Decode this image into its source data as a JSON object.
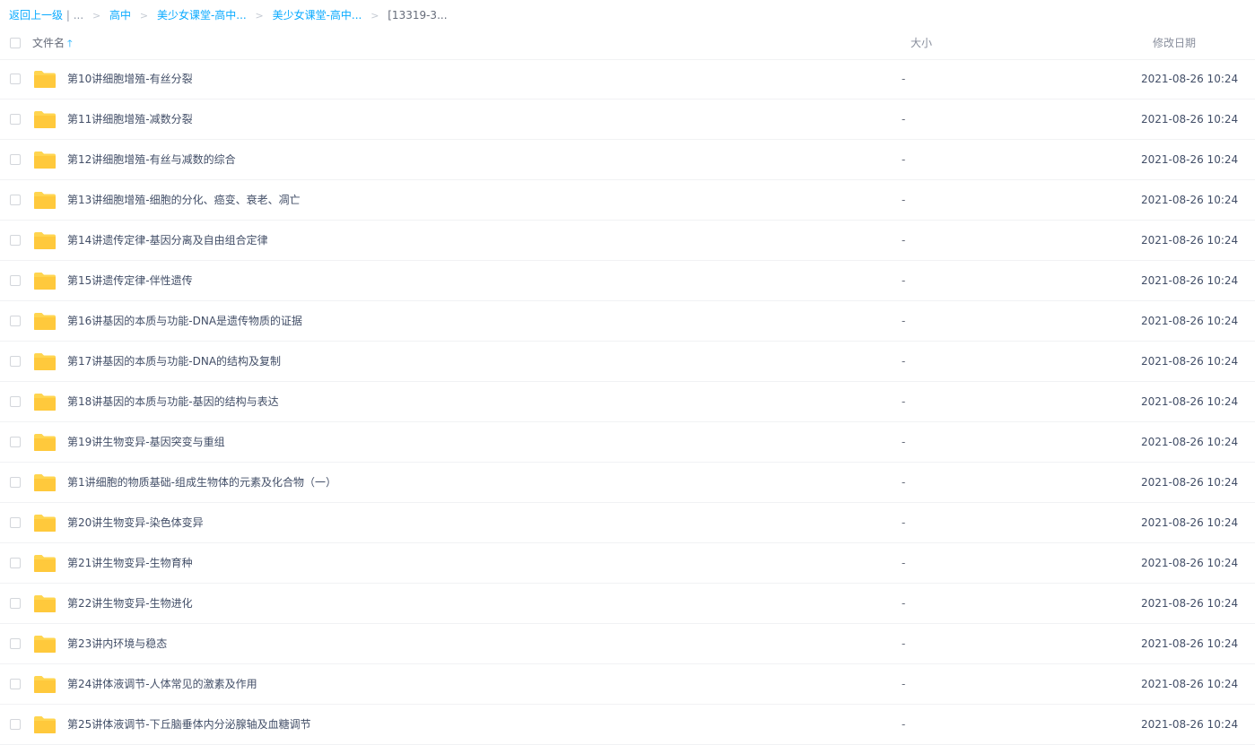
{
  "breadcrumb": {
    "back": "返回上一级",
    "divider": "|",
    "ellipsis": "...",
    "items": [
      "高中",
      "美少女课堂-高中...",
      "美少女课堂-高中..."
    ],
    "current": "[13319-3...",
    "separator": ">"
  },
  "header": {
    "name": "文件名",
    "sort_icon": "arrow-up-icon",
    "size": "大小",
    "date": "修改日期"
  },
  "colors": {
    "accent": "#09aaff",
    "folder": "#ffd54f"
  },
  "files": [
    {
      "name": "第10讲细胞增殖-有丝分裂",
      "size": "-",
      "date": "2021-08-26 10:24"
    },
    {
      "name": "第11讲细胞增殖-减数分裂",
      "size": "-",
      "date": "2021-08-26 10:24"
    },
    {
      "name": "第12讲细胞增殖-有丝与减数的综合",
      "size": "-",
      "date": "2021-08-26 10:24"
    },
    {
      "name": "第13讲细胞增殖-细胞的分化、癌变、衰老、凋亡",
      "size": "-",
      "date": "2021-08-26 10:24"
    },
    {
      "name": "第14讲遗传定律-基因分离及自由组合定律",
      "size": "-",
      "date": "2021-08-26 10:24"
    },
    {
      "name": "第15讲遗传定律-伴性遗传",
      "size": "-",
      "date": "2021-08-26 10:24"
    },
    {
      "name": "第16讲基因的本质与功能-DNA是遗传物质的证据",
      "size": "-",
      "date": "2021-08-26 10:24"
    },
    {
      "name": "第17讲基因的本质与功能-DNA的结构及复制",
      "size": "-",
      "date": "2021-08-26 10:24"
    },
    {
      "name": "第18讲基因的本质与功能-基因的结构与表达",
      "size": "-",
      "date": "2021-08-26 10:24"
    },
    {
      "name": "第19讲生物变异-基因突变与重组",
      "size": "-",
      "date": "2021-08-26 10:24"
    },
    {
      "name": "第1讲细胞的物质基础-组成生物体的元素及化合物（一）",
      "size": "-",
      "date": "2021-08-26 10:24"
    },
    {
      "name": "第20讲生物变异-染色体变异",
      "size": "-",
      "date": "2021-08-26 10:24"
    },
    {
      "name": "第21讲生物变异-生物育种",
      "size": "-",
      "date": "2021-08-26 10:24"
    },
    {
      "name": "第22讲生物变异-生物进化",
      "size": "-",
      "date": "2021-08-26 10:24"
    },
    {
      "name": "第23讲内环境与稳态",
      "size": "-",
      "date": "2021-08-26 10:24"
    },
    {
      "name": "第24讲体液调节-人体常见的激素及作用",
      "size": "-",
      "date": "2021-08-26 10:24"
    },
    {
      "name": "第25讲体液调节-下丘脑垂体内分泌腺轴及血糖调节",
      "size": "-",
      "date": "2021-08-26 10:24"
    }
  ]
}
